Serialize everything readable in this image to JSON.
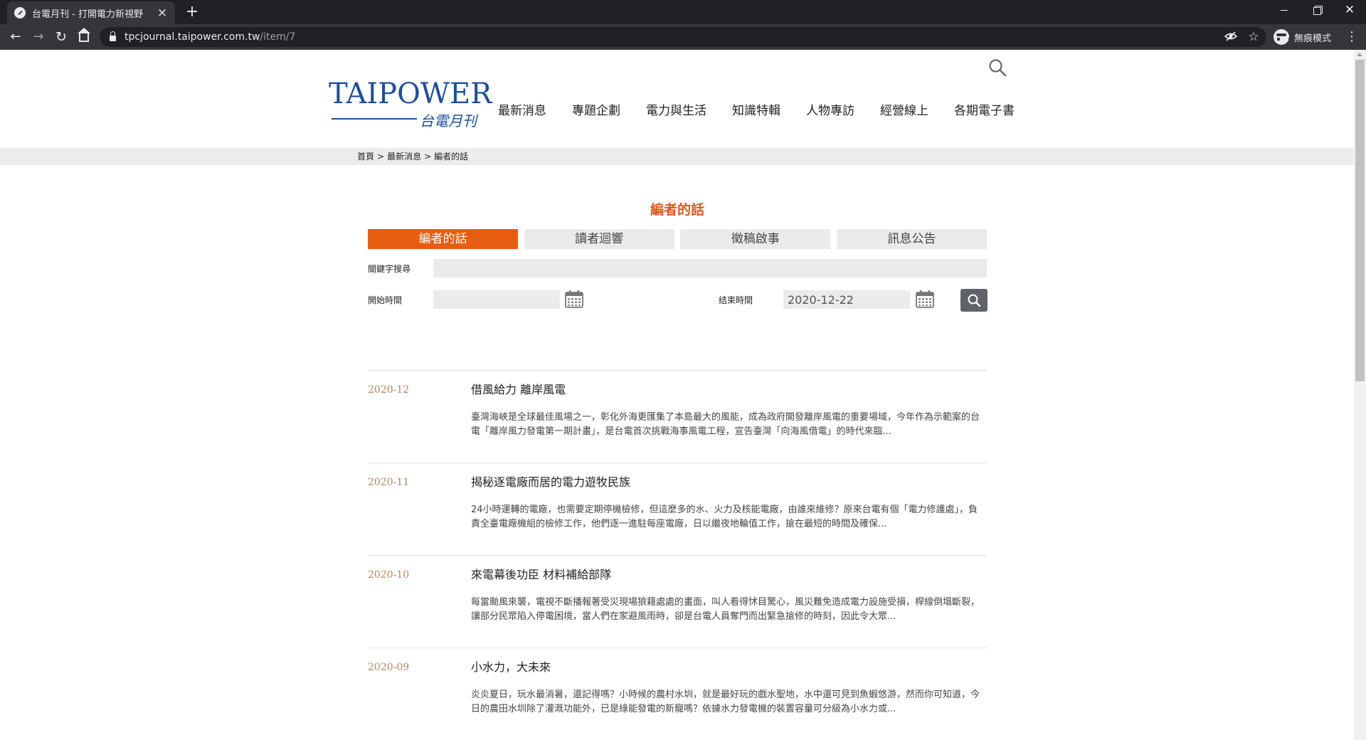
{
  "browser": {
    "tab_title": "台電月刊 - 打開電力新視野",
    "url_host": "tpcjournal.taipower.com.tw",
    "url_path": "/item/7",
    "incognito_label": "無痕模式"
  },
  "site": {
    "logo_text": "TAIPOWER",
    "logo_subtitle": "台電月刊",
    "nav": [
      "最新消息",
      "專題企劃",
      "電力與生活",
      "知識特輯",
      "人物專訪",
      "經營線上",
      "各期電子書"
    ]
  },
  "breadcrumb": {
    "home": "首頁",
    "sep1": ">",
    "section": "最新消息",
    "sep2": ">",
    "current": "編者的話"
  },
  "page_title": "編者的話",
  "tabs": [
    {
      "label": "編者的話",
      "active": true
    },
    {
      "label": "讀者迴響",
      "active": false
    },
    {
      "label": "徵稿啟事",
      "active": false
    },
    {
      "label": "訊息公告",
      "active": false
    }
  ],
  "filters": {
    "keyword_label": "關鍵字搜尋",
    "keyword_value": "",
    "start_label": "開始時間",
    "start_value": "",
    "end_label": "结束時間",
    "end_value": "2020-12-22"
  },
  "articles": [
    {
      "date": "2020-12",
      "title": "借風給力 離岸風電",
      "excerpt": "臺灣海峽是全球最佳風場之一，彰化外海更匯集了本島最大的風能，成為政府開發離岸風電的重要場域，今年作為示範案的台電「離岸風力發電第一期計畫」，是台電首次挑戰海事風電工程，宣告臺灣「向海風借電」的時代來臨..."
    },
    {
      "date": "2020-11",
      "title": "揭秘逐電廠而居的電力遊牧民族",
      "excerpt": "24小時運轉的電廠，也需要定期停機檢修，但這麼多的水、火力及核能電廠，由誰來維修？原來台電有個「電力修護處」，負責全臺電廠機組的檢修工作，他們逐一進駐每座電廠，日以繼夜地輪值工作，搶在最短的時間及確保..."
    },
    {
      "date": "2020-10",
      "title": "來電幕後功臣 材料補給部隊",
      "excerpt": "每當颱風來襲，電視不斷播報著受災現場狼藉處處的畫面，叫人看得怵目驚心，風災難免造成電力設施受損，桿線倒塌斷裂，讓部分民眾陷入停電困境，當人們在家避風雨時，卻是台電人員奪門而出緊急搶修的時刻，因此令大眾..."
    },
    {
      "date": "2020-09",
      "title": "小水力，大未來",
      "excerpt": "炎炎夏日，玩水最消暑，還記得嗎？小時候的農村水圳，就是最好玩的戲水聖地，水中還可見到魚蝦悠游，然而你可知道，今日的農田水圳除了灌溉功能外，已是綠能發電的新寵嗎？依據水力發電機的裝置容量可分級為小水力或..."
    }
  ],
  "colors": {
    "accent": "#e85c12",
    "title_orange": "#e0561a",
    "logo_blue": "#1a4ea0",
    "date_brown": "#b7865a"
  }
}
